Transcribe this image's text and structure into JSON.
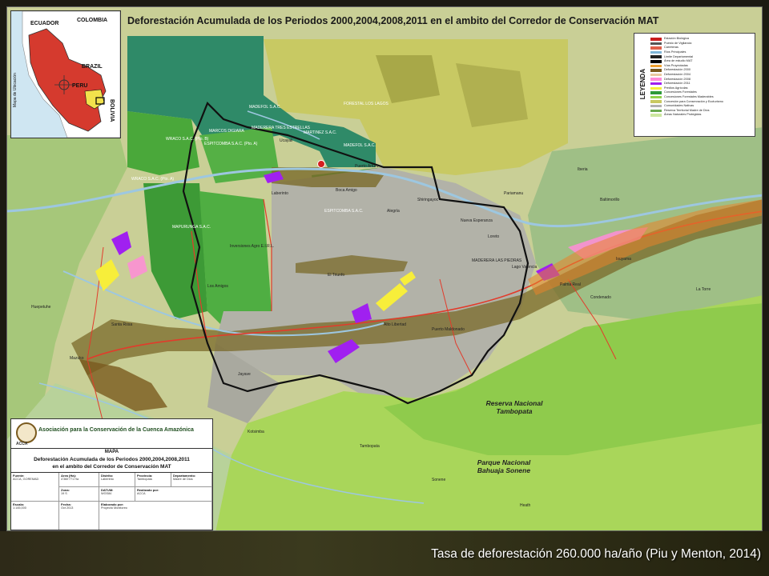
{
  "title": "Deforestación Acumulada de los Periodos 2000,2004,2008,2011 en el ambito del Corredor de Conservación MAT",
  "inset": {
    "countries": [
      "ECUADOR",
      "COLOMBIA",
      "BRAZIL",
      "PERU",
      "BOLIVIA"
    ],
    "side_label": "Mapa de Ubicación"
  },
  "legend": {
    "title": "LEYENDA",
    "items": [
      {
        "label": "Estación Biológica",
        "color": "#c81e1e"
      },
      {
        "label": "Puesto de Vigilancia",
        "color": "#555555"
      },
      {
        "label": "Carreteras",
        "color": "#e0604a"
      },
      {
        "label": "Ríos Principales",
        "color": "#7fb6d8"
      },
      {
        "label": "Limite Departamental",
        "color": "#222222"
      },
      {
        "label": "Área de estudio MAT",
        "color": "#000000"
      },
      {
        "label": "Vías Proyectadas",
        "color": "#f0a030"
      },
      {
        "label": "Deforestación 2000",
        "color": "#7a5a1e"
      },
      {
        "label": "Deforestación 2004",
        "color": "#e8c8a0"
      },
      {
        "label": "Deforestación 2008",
        "color": "#ff8cd8"
      },
      {
        "label": "Deforestación 2011",
        "color": "#a020f0"
      },
      {
        "label": "Predios Agrícolas",
        "color": "#f7ee3a"
      },
      {
        "label": "Concesiones Forestales",
        "color": "#2e9a3a"
      },
      {
        "label": "Concesiones Forestales Maderables",
        "color": "#8fd24a"
      },
      {
        "label": "Concesión para Conservación y Ecoturismo",
        "color": "#c8c860"
      },
      {
        "label": "Comunidades Nativas",
        "color": "#b0b0b0"
      },
      {
        "label": "Reserva Territorial Madre de Dios",
        "color": "#6aa84f"
      },
      {
        "label": "Áreas Naturales Protegidas",
        "color": "#cce6a0"
      }
    ]
  },
  "map_labels": {
    "concessions": [
      "MADEFOL S.A.C.",
      "FORESTAL LOS LAGOS",
      "MARCOS DIGIARA",
      "MADERERA TRES ESTRELLAS",
      "MARTINEZ S.A.C.",
      "WRACO S.A.C. (Pto. B)",
      "ESPITCOMBA S.A.C. (Pto. A)",
      "MADEFOL S.A.C.",
      "WRACO S.A.C. (Pto. A)",
      "ESPITCOMBA S.A.C.",
      "MAPURUNGA S.A.C.",
      "Inversiones Agro E.I.R.L.",
      "MADERERA LAS PIEDRAS"
    ],
    "places": [
      "Ucayali",
      "Puerto Arturo",
      "Boca Amigo",
      "Laberinto",
      "Shiringayoc",
      "Alegría",
      "Nueva Esperanza",
      "Loreto",
      "Iberia",
      "Alto Libertad",
      "Puerto Maldonado",
      "Huepetuhe",
      "Mazuko",
      "Santa Rosa",
      "Jayave",
      "Kotsimba",
      "Sonene",
      "Heath",
      "Tambopata",
      "Palma Real",
      "Condenado",
      "La Torre",
      "Baltimorillo",
      "Pariamanu",
      "Los Amigos",
      "El Triunfo",
      "Lago Valencia",
      "Isuyama"
    ],
    "reserve_tambopata": "Reserva Nacional\nTambopata",
    "park_bahuaja": "Parque Nacional\nBahuaja Sonene"
  },
  "title_block": {
    "organization": "Asociación para la Conservación de la Cuenca Amazónica",
    "acronym": "ACCA",
    "map_label": "MAPA",
    "subtitle_line1": "Deforestación Acumulada de los Periodos 2000,2004,2008,2011",
    "subtitle_line2": "en el ambito del Corredor de Conservación MAT",
    "cells": [
      {
        "head": "Fuente:",
        "text": "ACCA, GOREMAD"
      },
      {
        "head": "Area (Ha):",
        "text": "4'360'771 Ha"
      },
      {
        "head": "Distrito:",
        "text": "Laberinto"
      },
      {
        "head": "Provincia:",
        "text": "Tambopata"
      },
      {
        "head": "Departamento:",
        "text": "Madre de Dios"
      },
      {
        "head": "Zona:",
        "text": "19 S"
      },
      {
        "head": "DATUM:",
        "text": "WGS84"
      },
      {
        "head": "Realizado por:",
        "text": "ACCA"
      },
      {
        "head": "Escala:",
        "text": "1:145,000"
      },
      {
        "head": "Fecha:",
        "text": "Oct 2013"
      },
      {
        "head": "Elaborado por:",
        "text": "Proyecto Monitoreo"
      }
    ]
  },
  "caption": "Tasa de deforestación 260.000 ha/año (Piu y Menton, 2014)"
}
